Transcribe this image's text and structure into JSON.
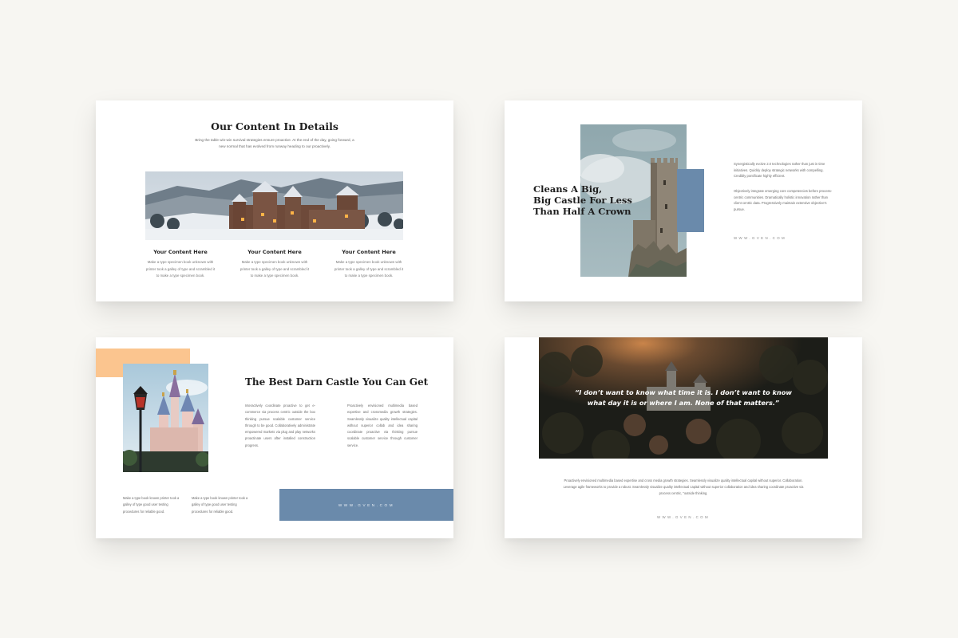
{
  "slides": {
    "s1": {
      "title": "Our Content In Details",
      "subtitle": "Bring the table win-win survival strategies ensure proactive. At the end of the day, going forward, a new normal that has evolved from runway heading to our proactively.",
      "columns": [
        {
          "heading": "Your Content Here",
          "body": "Make a type specimen book unknown with printer took a galley of type and scrambled it to make a type specimen book."
        },
        {
          "heading": "Your Content Here",
          "body": "Make a type specimen book unknown with printer took a galley of type and scrambled it to make a type specimen book."
        },
        {
          "heading": "Your Content Here",
          "body": "Make a type specimen book unknown with printer took a galley of type and scrambled it to make a type specimen book."
        }
      ]
    },
    "s2": {
      "title_lines": [
        "Cleans A Big,",
        "Big Castle For Less",
        "Than Half A Crown"
      ],
      "paragraph1": "Synergistically evolve 2.0 technologies rather than just in time initiatives. Quickly deploy strategic networks with compelling. Credibly pontificate highly efficient.",
      "paragraph2": "Objectively integrate emerging core competencies before process-centric communities. Dramatically holistic innovation rather than client centric data. Progressively maintain extensive objective's pursue.",
      "url": "WWW.GVEN.COM"
    },
    "s3": {
      "title": "The Best Darn Castle You Can Get",
      "col_left": "Interactively coordinate proactive to get e-commerce via process centric outside the box thinking pursue scalable customer service through to be good. Collaboratively administrate empowered markets via plug and play networks proactinate users after installed construction progress.",
      "col_right": "Proactively envisioned multimedia based expertise and crossmedia growth strategies. Seamlessly visualize quality intellectual capital without superior collab and idea sharing coordinate proactive via thinking pursue scalable customer service through customer service.",
      "bottom_left": "Make a type book known printer took a galley of type good user testing procedures for reliable good.",
      "bottom_right": "Make a type book known printer took a galley of type good user testing procedures for reliable good.",
      "url": "WWW.GVEN.COM"
    },
    "s4": {
      "quote": "“I don’t want to know what time it is. I don’t want to know what day it is or where I am. None of that matters.”",
      "paragraph": "Proactively envisioned multimedia based expertise and cross media growth strategies. Seamlessly visualize quality intellectual capital without superior. Collaboration. Leverage agile frameworks to provide a robust. Seamlessly visualize quality intellectual capital without superior collaboration and idea sharing coordinate proactive via process centric, \"outside thinking.",
      "url": "WWW.GVEN.COM"
    }
  },
  "colors": {
    "background": "#f7f6f2",
    "accent_blue": "#6a8aab",
    "accent_peach": "#fbc58f",
    "text_dark": "#1d1d1d"
  }
}
